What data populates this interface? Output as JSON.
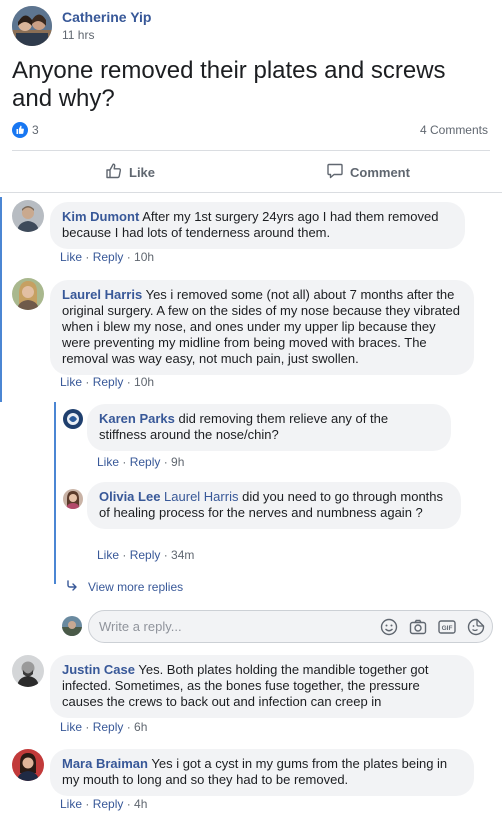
{
  "post": {
    "author": "Catherine Yip",
    "time": "11 hrs",
    "text": "Anyone removed their plates and screws and why?",
    "like_count": "3",
    "comment_count": "4 Comments"
  },
  "actions": {
    "like": "Like",
    "comment": "Comment"
  },
  "meta": {
    "like": "Like",
    "sep": " · ",
    "reply": "Reply"
  },
  "comments": [
    {
      "name": "Kim Dumont",
      "text": "After my 1st surgery 24yrs ago I had them removed because I had lots of tenderness around them.",
      "time": "10h"
    },
    {
      "name": "Laurel Harris",
      "text": "Yes i removed some (not all) about 7 months after the original surgery. A few on the sides of my nose because they vibrated when i blew my nose, and ones under my upper lip because they were preventing my midline from being moved with braces. The removal was way easy, not much pain, just swollen.",
      "time": "10h"
    },
    {
      "name": "Karen Parks",
      "text": "did removing them relieve any of the stiffness around the nose/chin?",
      "time": "9h"
    },
    {
      "name": "Olivia Lee",
      "tag": "Laurel Harris",
      "text": "did you need to go through months of healing process for the nerves and numbness again ?",
      "time": "34m"
    },
    {
      "name": "Justin Case",
      "text": "Yes. Both plates holding the mandible together got infected. Sometimes, as the bones fuse together, the pressure causes the crews to back out and infection can creep in",
      "time": "6h"
    },
    {
      "name": "Mara Braiman",
      "text": "Yes i got a cyst in my gums from the plates being in my mouth to long and so they had to be removed.",
      "time": "4h"
    }
  ],
  "view_more": "View more replies",
  "reply_placeholder": "Write a reply...",
  "colors": {
    "accent": "#385898",
    "like_blue": "#1877f2",
    "thread": "#4b86d3",
    "bubble": "#f2f3f5"
  }
}
